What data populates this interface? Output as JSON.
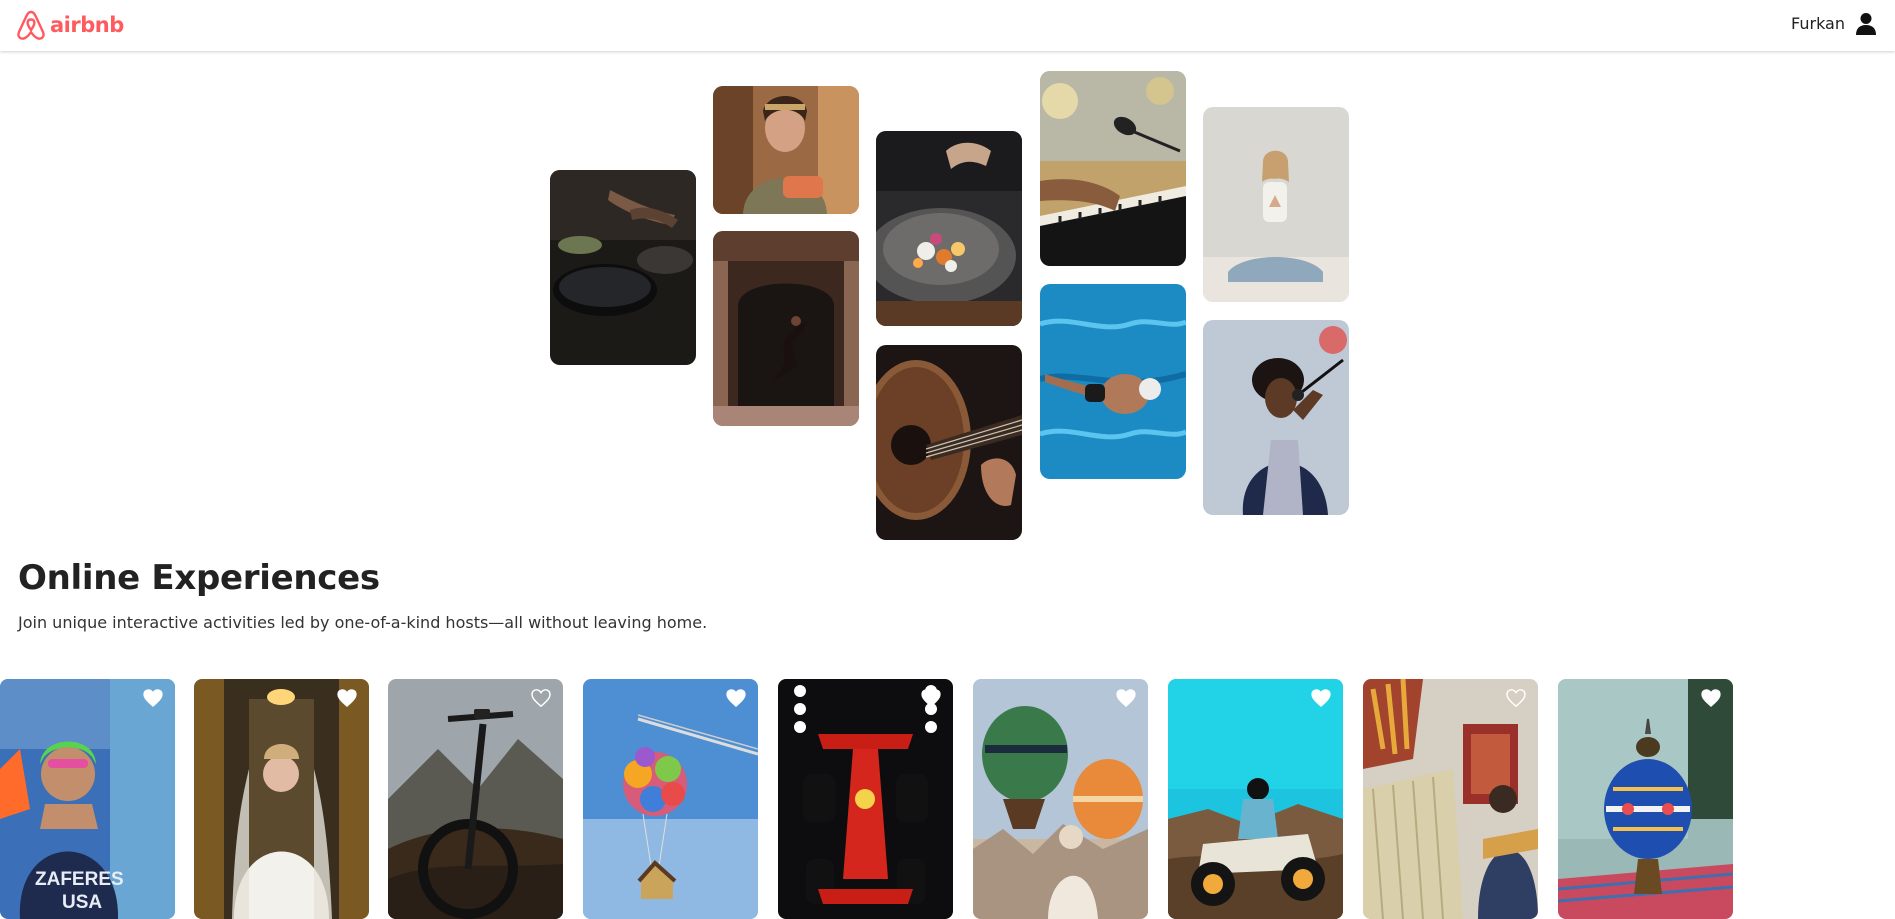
{
  "nav": {
    "logo_text": "airbnb",
    "brand_color": "#ff5a5f",
    "user_name": "Furkan",
    "user_icon": "person-icon"
  },
  "hero": {
    "tiles": [
      {
        "subject": "cooking-pans-photo"
      },
      {
        "subject": "woman-holding-food-photo"
      },
      {
        "subject": "dancer-in-doorway-photo"
      },
      {
        "subject": "plated-dish-photo"
      },
      {
        "subject": "acoustic-guitar-photo"
      },
      {
        "subject": "piano-microphone-photo"
      },
      {
        "subject": "swimmer-pool-photo"
      },
      {
        "subject": "yoga-meditation-photo"
      },
      {
        "subject": "singer-microphone-photo"
      }
    ]
  },
  "section": {
    "title": "Online Experiences",
    "subtitle": "Join unique interactive activities led by one-of-a-kind hosts—all without leaving home."
  },
  "cards": [
    {
      "subject": "swimmer-athlete",
      "shirt_text": "ZAFERES",
      "shirt_text2": "USA"
    },
    {
      "subject": "bride-in-hallway"
    },
    {
      "subject": "bicycle-on-hill"
    },
    {
      "subject": "balloon-house"
    },
    {
      "subject": "red-race-car"
    },
    {
      "subject": "hot-air-balloons"
    },
    {
      "subject": "atv-rider"
    },
    {
      "subject": "carpet-weaver"
    },
    {
      "subject": "mosaic-lamp"
    }
  ]
}
